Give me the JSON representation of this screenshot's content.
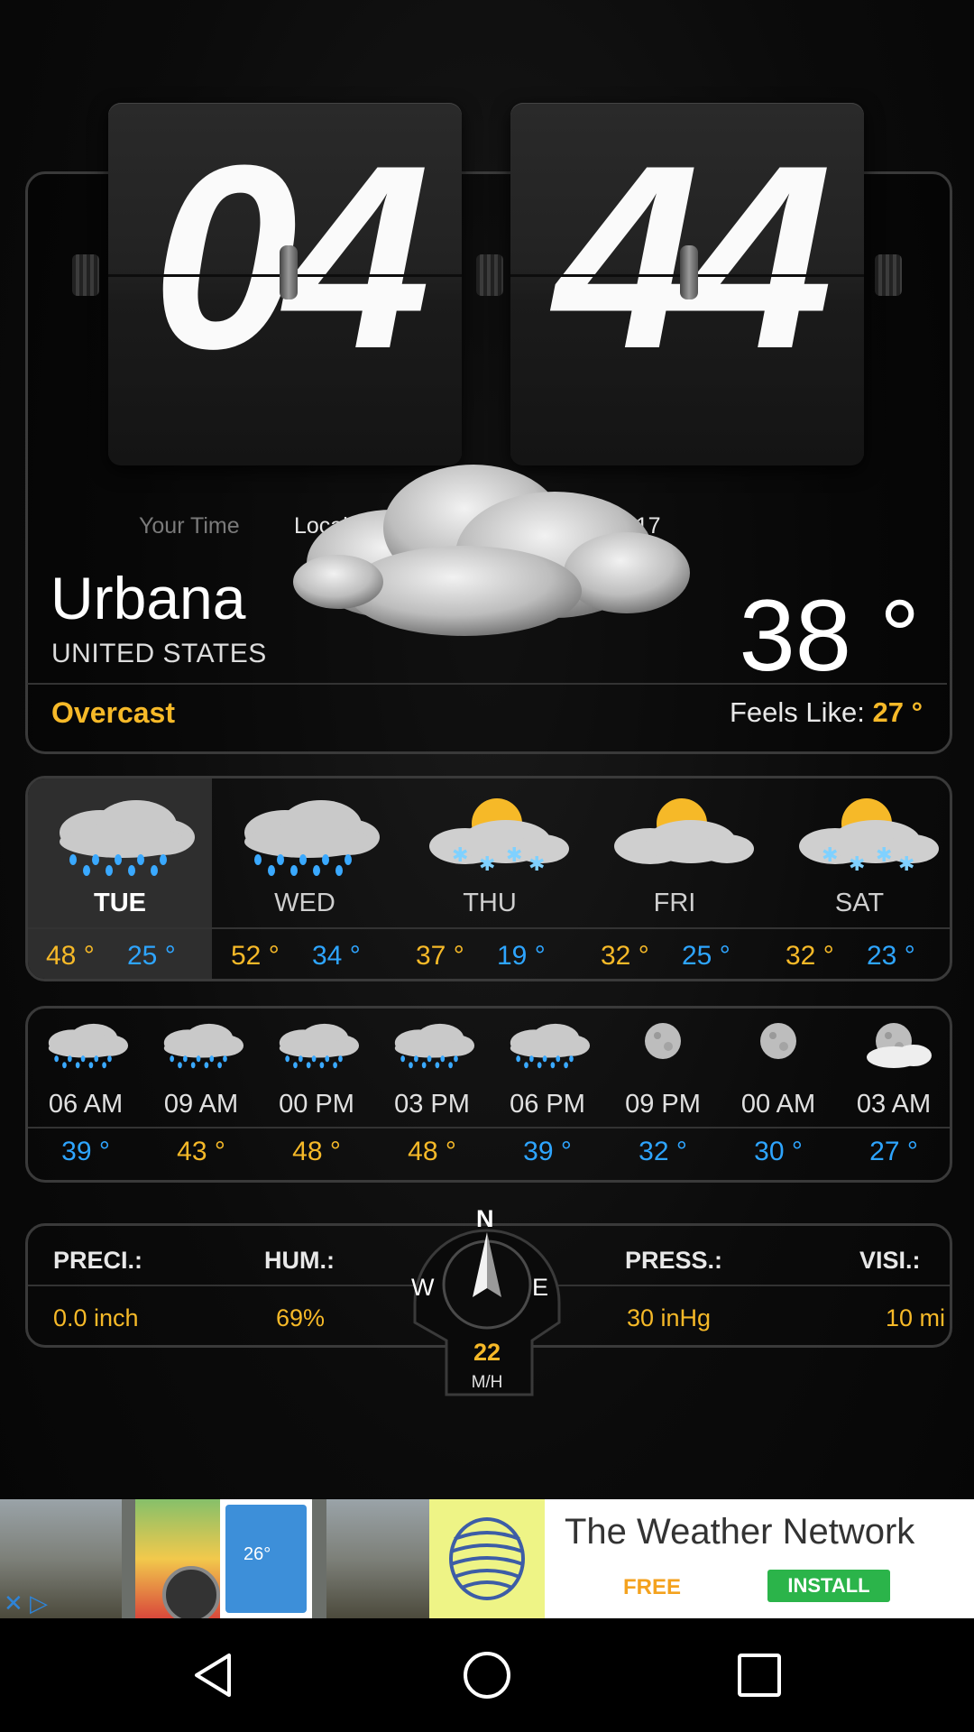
{
  "clock": {
    "hours": "04",
    "minutes": "44",
    "your_time_label": "Your Time",
    "local_time_label": "Local Time",
    "date": "Jan 10, 2017"
  },
  "current": {
    "city": "Urbana",
    "country": "UNITED STATES",
    "temperature": "38 °",
    "condition": "Overcast",
    "feels_like_label": "Feels Like:",
    "feels_like_value": "27 °"
  },
  "daily": [
    {
      "day": "TUE",
      "high": "48 °",
      "low": "25 °",
      "icon": "rain-cloud-icon",
      "selected": true
    },
    {
      "day": "WED",
      "high": "52 °",
      "low": "34 °",
      "icon": "rain-cloud-icon"
    },
    {
      "day": "THU",
      "high": "37 °",
      "low": "19 °",
      "icon": "sun-snow-cloud-icon"
    },
    {
      "day": "FRI",
      "high": "32 °",
      "low": "25 °",
      "icon": "sun-cloud-icon"
    },
    {
      "day": "SAT",
      "high": "32 °",
      "low": "23 °",
      "icon": "sun-snow-cloud-icon"
    }
  ],
  "hourly": [
    {
      "time": "06 AM",
      "temp": "39 °",
      "color": "#2ea5ff",
      "icon": "rain-cloud-icon"
    },
    {
      "time": "09 AM",
      "temp": "43 °",
      "color": "#f6b928",
      "icon": "rain-cloud-icon"
    },
    {
      "time": "00 PM",
      "temp": "48 °",
      "color": "#f6b928",
      "icon": "rain-cloud-icon"
    },
    {
      "time": "03 PM",
      "temp": "48 °",
      "color": "#f6b928",
      "icon": "rain-cloud-icon"
    },
    {
      "time": "06 PM",
      "temp": "39 °",
      "color": "#2ea5ff",
      "icon": "rain-cloud-icon"
    },
    {
      "time": "09 PM",
      "temp": "32 °",
      "color": "#2ea5ff",
      "icon": "moon-icon"
    },
    {
      "time": "00 AM",
      "temp": "30 °",
      "color": "#2ea5ff",
      "icon": "moon-icon"
    },
    {
      "time": "03 AM",
      "temp": "27 °",
      "color": "#2ea5ff",
      "icon": "moon-cloud-icon"
    }
  ],
  "details": {
    "precip_label": "PRECI.:",
    "precip_value": "0.0 inch",
    "humidity_label": "HUM.:",
    "humidity_value": "69%",
    "pressure_label": "PRESS.:",
    "pressure_value": "30 inHg",
    "visibility_label": "VISI.:",
    "visibility_value": "10 mi"
  },
  "wind": {
    "n": "N",
    "e": "E",
    "w": "W",
    "speed": "22",
    "unit": "M/H"
  },
  "ad": {
    "title": "The Weather Network",
    "free_label": "FREE",
    "install_label": "INSTALL",
    "thumb_temp": "26°"
  },
  "colors": {
    "accent_yellow": "#f6b928",
    "accent_blue": "#2ea5ff"
  }
}
